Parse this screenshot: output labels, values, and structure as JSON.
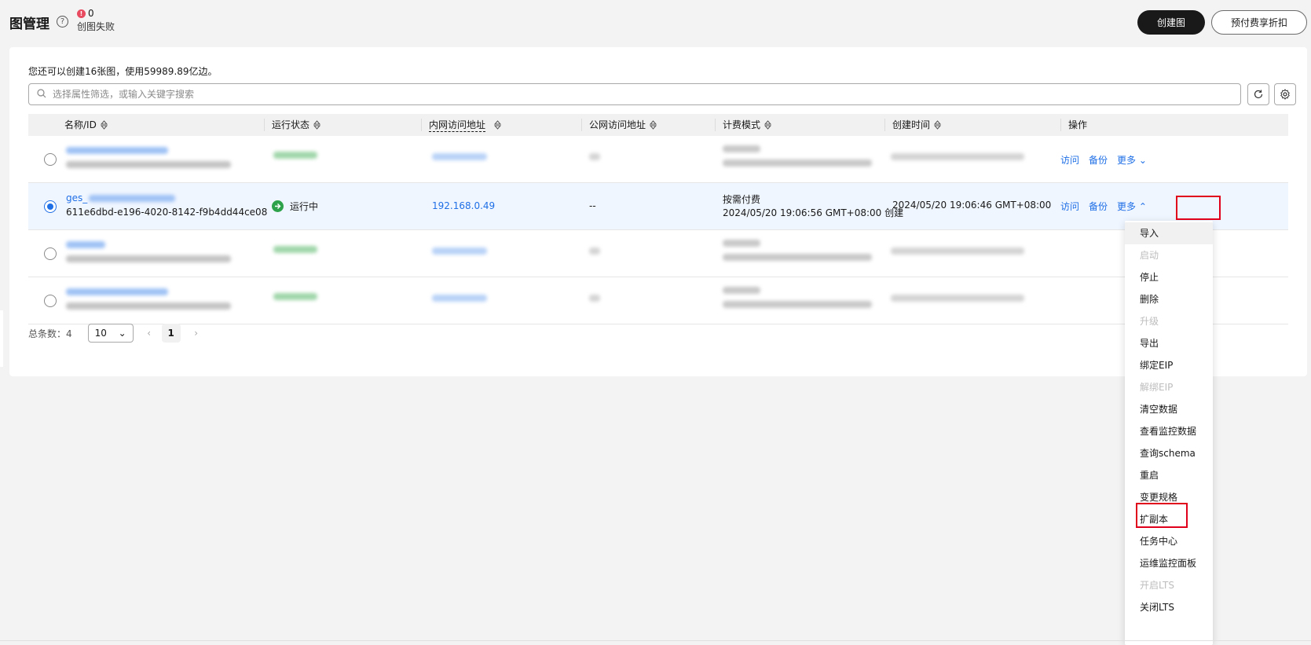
{
  "header": {
    "title": "图管理",
    "help_icon": "?",
    "fail_count": "0",
    "fail_label": "创图失败",
    "create_button": "创建图",
    "prepay_button": "预付费享折扣"
  },
  "quota_text": "您还可以创建16张图，使用59989.89亿边。",
  "search": {
    "placeholder": "选择属性筛选，或输入关键字搜索"
  },
  "columns": [
    "名称/ID",
    "运行状态",
    "内网访问地址",
    "公网访问地址",
    "计费模式",
    "创建时间",
    "操作"
  ],
  "selected_row": {
    "name": "ges_",
    "id": "611e6dbd-e196-4020-8142-f9b4dd44ce08",
    "status": "运行中",
    "private_ip": "192.168.0.49",
    "public_ip": "--",
    "billing_mode": "按需付费",
    "billing_created": "2024/05/20 19:06:56 GMT+08:00 创建",
    "created_time": "2024/05/20 19:06:46 GMT+08:00"
  },
  "row_actions": {
    "visit": "访问",
    "backup": "备份",
    "more": "更多"
  },
  "pagination": {
    "total_label": "总条数：4",
    "page_size": "10",
    "current_page": "1"
  },
  "more_menu": [
    {
      "label": "导入",
      "disabled": false
    },
    {
      "label": "启动",
      "disabled": true
    },
    {
      "label": "停止",
      "disabled": false
    },
    {
      "label": "删除",
      "disabled": false
    },
    {
      "label": "升级",
      "disabled": true
    },
    {
      "label": "导出",
      "disabled": false
    },
    {
      "label": "绑定EIP",
      "disabled": false
    },
    {
      "label": "解绑EIP",
      "disabled": true
    },
    {
      "label": "清空数据",
      "disabled": false
    },
    {
      "label": "查看监控数据",
      "disabled": false
    },
    {
      "label": "查询schema",
      "disabled": false
    },
    {
      "label": "重启",
      "disabled": false
    },
    {
      "label": "变更规格",
      "disabled": false
    },
    {
      "label": "扩副本",
      "disabled": false
    },
    {
      "label": "任务中心",
      "disabled": false
    },
    {
      "label": "运维监控面板",
      "disabled": false
    },
    {
      "label": "开启LTS",
      "disabled": true
    },
    {
      "label": "关闭LTS",
      "disabled": false
    }
  ],
  "colors": {
    "accent": "#1f6fe6",
    "running": "#2da24a",
    "highlight_box": "#e0001b",
    "dark_button": "#191919"
  }
}
